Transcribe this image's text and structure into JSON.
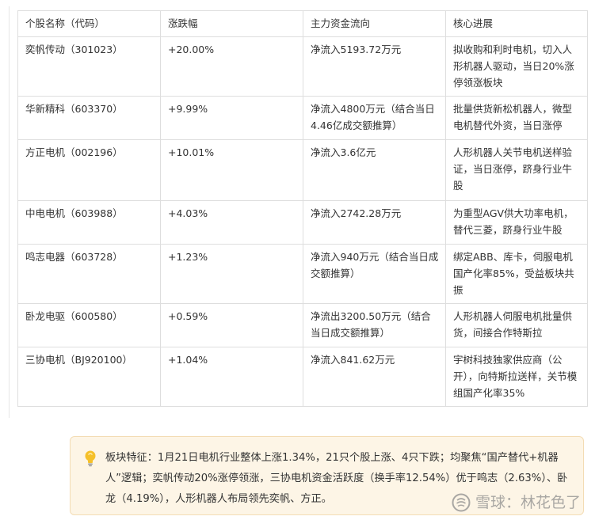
{
  "table": {
    "headers": [
      "个股名称（代码）",
      "涨跌幅",
      "主力资金流向",
      "核心进展"
    ],
    "rows": [
      {
        "name": "奕帆传动（301023）",
        "change": "+20.00%",
        "flow": "净流入5193.72万元",
        "progress": "拟收购和利时电机，切入人形机器人驱动，当日20%涨停领涨板块"
      },
      {
        "name": "华新精科（603370）",
        "change": "+9.99%",
        "flow": "净流入4800万元（结合当日4.46亿成交额推算）",
        "progress": "批量供货新松机器人，微型电机替代外资，当日涨停"
      },
      {
        "name": "方正电机（002196）",
        "change": "+10.01%",
        "flow": "净流入3.6亿元",
        "progress": "人形机器人关节电机送样验证，当日涨停，跻身行业牛股"
      },
      {
        "name": "中电电机（603988）",
        "change": "+4.03%",
        "flow": "净流入2742.28万元",
        "progress": "为重型AGV供大功率电机，替代三菱，跻身行业牛股"
      },
      {
        "name": "鸣志电器（603728）",
        "change": "+1.23%",
        "flow": "净流入940万元（结合当日成交额推算）",
        "progress": "绑定ABB、库卡，伺服电机国产化率85%，受益板块共振"
      },
      {
        "name": "卧龙电驱（600580）",
        "change": "+0.59%",
        "flow": "净流出3200.50万元（结合当日成交额推算）",
        "progress": "人形机器人伺服电机批量供货，间接合作特斯拉"
      },
      {
        "name": "三协电机（BJ920100）",
        "change": "+1.04%",
        "flow": "净流入841.62万元",
        "progress": "宇树科技独家供应商（公开），向特斯拉送样，关节模组国产化率35%"
      }
    ]
  },
  "note": {
    "icon": "lightbulb-icon",
    "text": "板块特征：1月21日电机行业整体上涨1.34%，21只个股上涨、4只下跌；均聚焦“国产替代+机器人”逻辑；奕帆传动20%涨停领涨，三协电机资金活跃度（换手率12.54%）优于鸣志（2.63%）、卧龙（4.19%），人形机器人布局领先奕帆、方正。"
  },
  "watermark": {
    "text": "雪球：林花色了"
  },
  "colors": {
    "border": "#dedede",
    "note_bg": "#fdf5e6",
    "note_border": "#f3dcb4",
    "bulb": "#f5c02a"
  }
}
